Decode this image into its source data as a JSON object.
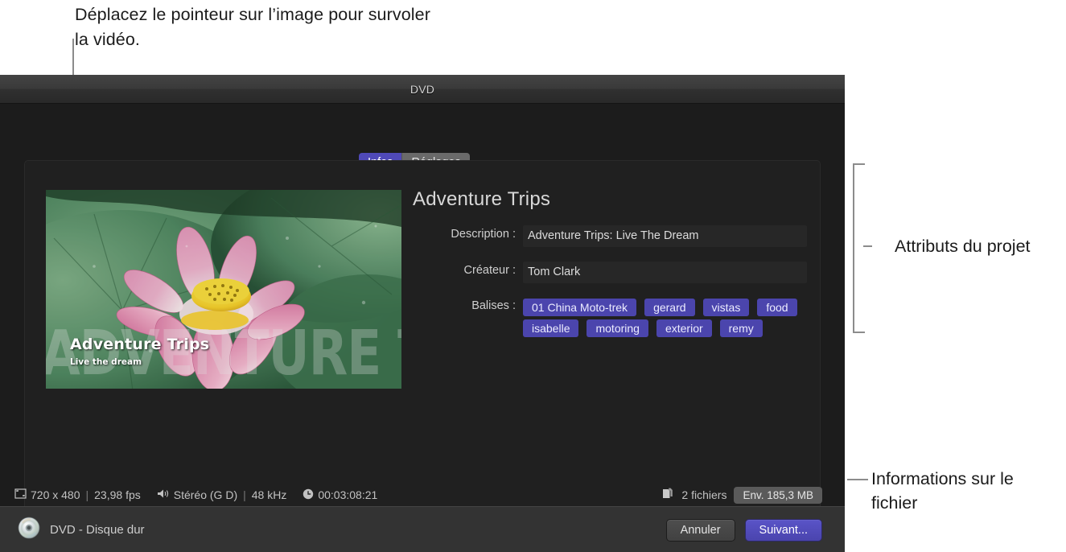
{
  "callout": {
    "text": "Déplacez le pointeur sur l’image pour survoler la vidéo."
  },
  "window": {
    "title": "DVD"
  },
  "tabs": [
    {
      "label": "Infos",
      "selected": true
    },
    {
      "label": "Réglages",
      "selected": false
    }
  ],
  "thumbnail": {
    "watermark": "ADVENTURE TRIPS",
    "overlay_title": "Adventure Trips",
    "overlay_subtitle": "Live the dream",
    "icon": "video-thumbnail"
  },
  "project": {
    "title": "Adventure Trips",
    "fields": [
      {
        "label": "Description :",
        "value": "Adventure Trips: Live The Dream"
      },
      {
        "label": "Créateur :",
        "value": "Tom Clark"
      }
    ],
    "tags_label": "Balises :",
    "tags": [
      "01 China Moto-trek",
      "gerard",
      "vistas",
      "food",
      "isabelle",
      "motoring",
      "exterior",
      "remy"
    ]
  },
  "status": {
    "resolution": "720 x 480",
    "framerate": "23,98 fps",
    "audio": "Stéréo (G D)",
    "samplerate": "48 kHz",
    "duration": "00:03:08:21",
    "files": "2 fichiers",
    "size": "Env. 185,3 MB",
    "separator": "|",
    "icons": {
      "resolution": "frame-size-icon",
      "audio": "speaker-icon",
      "duration": "clock-icon",
      "files": "documents-icon"
    }
  },
  "bottom": {
    "disc_label": "DVD - Disque dur",
    "disc_icon": "dvd-disc-icon",
    "cancel_label": "Annuler",
    "next_label": "Suivant..."
  },
  "annotations": {
    "project_attributes": "Attributs du projet",
    "file_info": "Informations sur le fichier"
  },
  "colors": {
    "accent": "#4f49b8",
    "tag": "#4b45ad",
    "window_bg": "#1c1c1c",
    "titlebar": "#3a3a3a"
  }
}
